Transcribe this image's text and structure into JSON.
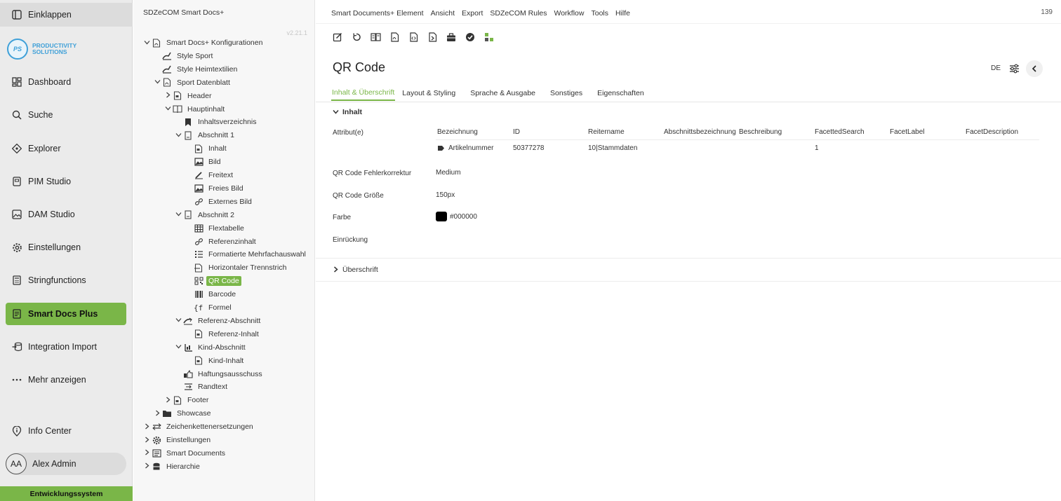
{
  "nav": {
    "collapse_label": "Einklappen",
    "logo_initials": "PS",
    "logo_line1": "PRODUCTIVITY",
    "logo_line2": "SOLUTIONS",
    "items": [
      {
        "label": "Dashboard",
        "icon": "dashboard-icon"
      },
      {
        "label": "Suche",
        "icon": "search-icon"
      },
      {
        "label": "Explorer",
        "icon": "explorer-icon"
      },
      {
        "label": "PIM Studio",
        "icon": "pim-studio-icon"
      },
      {
        "label": "DAM Studio",
        "icon": "image-icon"
      },
      {
        "label": "Einstellungen",
        "icon": "gear-icon"
      },
      {
        "label": "Stringfunctions",
        "icon": "calculator-icon"
      },
      {
        "label": "Smart Docs Plus",
        "icon": "document-icon"
      },
      {
        "label": "Integration Import",
        "icon": "database-import-icon"
      },
      {
        "label": "Mehr anzeigen",
        "icon": "more-icon"
      }
    ],
    "info_center": "Info Center",
    "user_initials": "AA",
    "user_name": "Alex Admin",
    "environment": "Entwicklungssystem",
    "accent": "#7ab648"
  },
  "tree": {
    "title": "SDZeCOM Smart Docs+",
    "version": "v2.21.1",
    "nodes": [
      {
        "label": "Smart Docs+ Konfigurationen",
        "chev": "open"
      },
      {
        "label": "Style Sport",
        "chev": ""
      },
      {
        "label": "Style Heimtextilien",
        "chev": ""
      },
      {
        "label": "Sport Datenblatt",
        "chev": "open"
      },
      {
        "label": "Header",
        "chev": "closed"
      },
      {
        "label": "Hauptinhalt",
        "chev": "open"
      },
      {
        "label": "Inhaltsverzeichnis",
        "chev": ""
      },
      {
        "label": "Abschnitt 1",
        "chev": "open"
      },
      {
        "label": "Inhalt",
        "chev": ""
      },
      {
        "label": "Bild",
        "chev": ""
      },
      {
        "label": "Freitext",
        "chev": ""
      },
      {
        "label": "Freies Bild",
        "chev": ""
      },
      {
        "label": "Externes Bild",
        "chev": ""
      },
      {
        "label": "Abschnitt 2",
        "chev": "open"
      },
      {
        "label": "Flextabelle",
        "chev": ""
      },
      {
        "label": "Referenzinhalt",
        "chev": ""
      },
      {
        "label": "Formatierte Mehrfachauswahl",
        "chev": ""
      },
      {
        "label": "Horizontaler Trennstrich",
        "chev": ""
      },
      {
        "label": "QR Code",
        "chev": "",
        "selected": true
      },
      {
        "label": "Barcode",
        "chev": ""
      },
      {
        "label": "Formel",
        "chev": ""
      },
      {
        "label": "Referenz-Abschnitt",
        "chev": "open"
      },
      {
        "label": "Referenz-Inhalt",
        "chev": ""
      },
      {
        "label": "Kind-Abschnitt",
        "chev": "open"
      },
      {
        "label": "Kind-Inhalt",
        "chev": ""
      },
      {
        "label": "Haftungsausschuss",
        "chev": ""
      },
      {
        "label": "Randtext",
        "chev": ""
      },
      {
        "label": "Footer",
        "chev": "closed"
      },
      {
        "label": "Showcase",
        "chev": "closed"
      },
      {
        "label": "Zeichenkettenersetzungen",
        "chev": "closed"
      },
      {
        "label": "Einstellungen",
        "chev": "closed"
      },
      {
        "label": "Smart Documents",
        "chev": "closed"
      },
      {
        "label": "Hierarchie",
        "chev": "closed"
      }
    ]
  },
  "menubar": {
    "items": [
      "Smart Documents+ Element",
      "Ansicht",
      "Export",
      "SDZeCOM Rules",
      "Workflow",
      "Tools",
      "Hilfe"
    ],
    "count": "139"
  },
  "toolbar": {
    "buttons": [
      "edit-icon",
      "reload-icon",
      "compare-icon",
      "pdf-icon",
      "code-file-icon",
      "export-file-icon",
      "briefcase-icon",
      "check-circle-icon",
      "structure-icon"
    ]
  },
  "page": {
    "title": "QR Code",
    "lang": "DE"
  },
  "tabs": [
    "Inhalt & Überschrift",
    "Layout & Styling",
    "Sprache & Ausgabe",
    "Sonstiges",
    "Eigenschaften"
  ],
  "content": {
    "section_inhalt": "Inhalt",
    "section_uberschrift": "Überschrift",
    "attr_label": "Attribut(e)",
    "columns": [
      "Bezeichnung",
      "ID",
      "Reitername",
      "Abschnittsbezeichnung",
      "Beschreibung",
      "FacettedSearch",
      "FacetLabel",
      "FacetDescription"
    ],
    "row": {
      "bezeichnung": "Artikelnummer",
      "id": "50377278",
      "reitername": "10|Stammdaten",
      "facetted": "1"
    },
    "fehler_label": "QR Code Fehlerkorrektur",
    "fehler_value": "Medium",
    "grosse_label": "QR Code Größe",
    "grosse_value": "150px",
    "farbe_label": "Farbe",
    "farbe_value": "#000000",
    "einruckung_label": "Einrückung"
  }
}
